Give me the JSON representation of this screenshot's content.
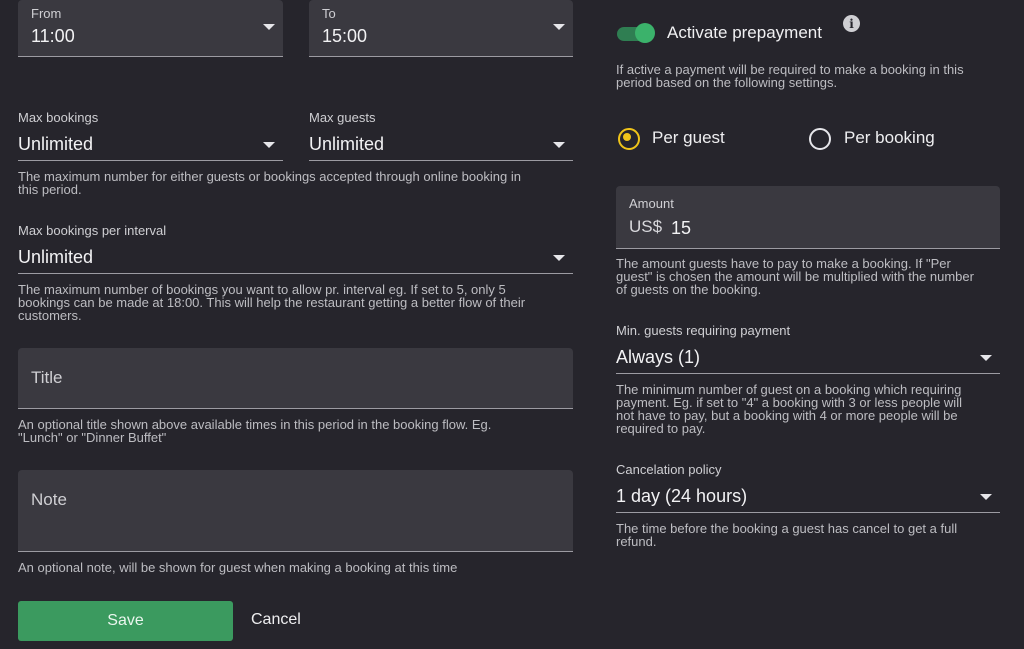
{
  "left": {
    "from": {
      "label": "From",
      "value": "11:00"
    },
    "to": {
      "label": "To",
      "value": "15:00"
    },
    "max_bookings": {
      "label": "Max bookings",
      "value": "Unlimited"
    },
    "max_guests": {
      "label": "Max guests",
      "value": "Unlimited"
    },
    "max_help": [
      "The maximum number for either guests or bookings accepted through online booking in",
      "this period."
    ],
    "max_per_interval": {
      "label": "Max bookings per interval",
      "value": "Unlimited"
    },
    "interval_help": [
      "The maximum number of bookings you want to allow pr. interval eg. If set to 5, only 5",
      "bookings can be made at 18:00. This will help the restaurant getting a better flow of their",
      "customers."
    ],
    "title_field": {
      "placeholder": "Title"
    },
    "title_help": [
      "An optional title shown above available times in this period in the booking flow. Eg.",
      "\"Lunch\" or \"Dinner Buffet\""
    ],
    "note_field": {
      "placeholder": "Note"
    },
    "note_help": "An optional note, will be shown for guest when making a booking at this time",
    "save_label": "Save",
    "cancel_label": "Cancel"
  },
  "right": {
    "toggle_label": "Activate prepayment",
    "toggle_on": true,
    "info_glyph": "i",
    "toggle_help": [
      "If active a payment will be required to make a booking in this",
      "period based on the following settings."
    ],
    "radio_per_guest": "Per guest",
    "radio_per_booking": "Per booking",
    "selected_radio": "per_guest",
    "amount": {
      "label": "Amount",
      "currency": "US$",
      "value": "15"
    },
    "amount_help": [
      "The amount guests have to pay to make a booking. If \"Per",
      "guest\" is chosen the amount will be multiplied with the number",
      "of guests on the booking."
    ],
    "min_guests": {
      "label": "Min. guests requiring payment",
      "value": "Always (1)"
    },
    "min_help": [
      "The minimum number of guest on a booking which requiring",
      "payment. Eg. if set to \"4\" a booking with 3 or less people will",
      "not have to pay, but a booking with 4 or more people will be",
      "required to pay."
    ],
    "cancel_policy": {
      "label": "Cancelation policy",
      "value": "1 day (24 hours)"
    },
    "cancel_help": [
      "The time before the booking a guest has cancel to get a full",
      "refund."
    ]
  },
  "colors": {
    "background": "#26252c",
    "field": "#3a3940",
    "accent_green": "#3b9a5f",
    "radio_yellow": "#f0c419"
  },
  "icons": [
    "chevron-down-icon",
    "info-icon",
    "radio-checked-icon",
    "radio-unchecked-icon"
  ]
}
